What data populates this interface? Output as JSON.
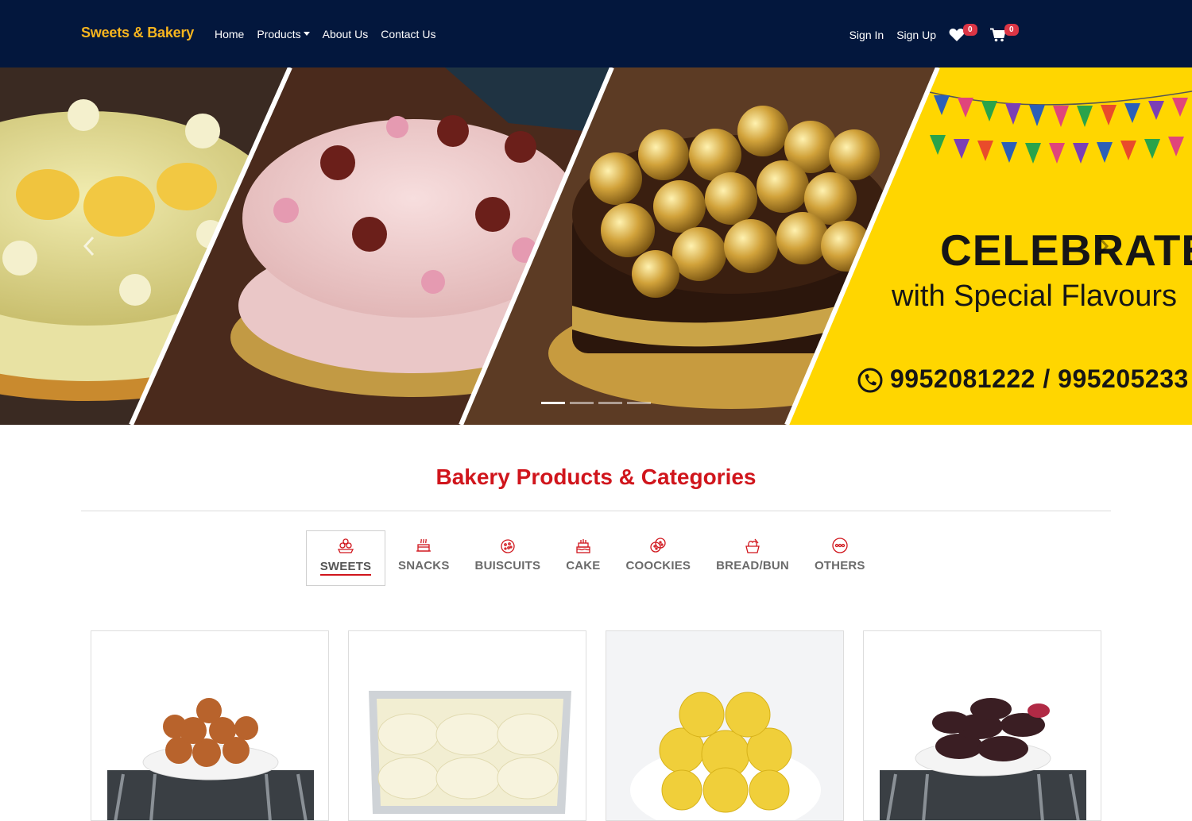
{
  "navbar": {
    "brand": "Sweets & Bakery",
    "links": [
      {
        "label": "Home"
      },
      {
        "label": "Products"
      },
      {
        "label": "About Us"
      },
      {
        "label": "Contact Us"
      }
    ],
    "sign_in": "Sign In",
    "sign_up": "Sign Up",
    "wishlist_count": "0",
    "cart_count": "0",
    "colors": {
      "background": "#03173d",
      "brand": "#f7b51e",
      "badge": "#dc3545"
    }
  },
  "hero": {
    "title": "CELEBRATE",
    "subtitle": "with Special Flavours",
    "phone": "9952081222 / 995205233",
    "slides": 4,
    "active_slide": 1,
    "accent": "#ffd600"
  },
  "categories": {
    "title": "Bakery Products & Categories",
    "title_color": "#d0151c",
    "tabs": [
      {
        "label": "SWEETS",
        "icon": "sweets-icon",
        "active": true
      },
      {
        "label": "SNACKS",
        "icon": "snacks-icon"
      },
      {
        "label": "BUISCUITS",
        "icon": "biscuits-icon"
      },
      {
        "label": "CAKE",
        "icon": "cake-icon"
      },
      {
        "label": "COOCKIES",
        "icon": "cookies-icon"
      },
      {
        "label": "BREAD/BUN",
        "icon": "bread-icon"
      },
      {
        "label": "OTHERS",
        "icon": "others-icon"
      }
    ]
  },
  "products": [
    {
      "image": "gulab-jamun-image"
    },
    {
      "image": "rasmalai-tray-image"
    },
    {
      "image": "boondi-ladoo-image"
    },
    {
      "image": "kala-jamun-image"
    }
  ]
}
